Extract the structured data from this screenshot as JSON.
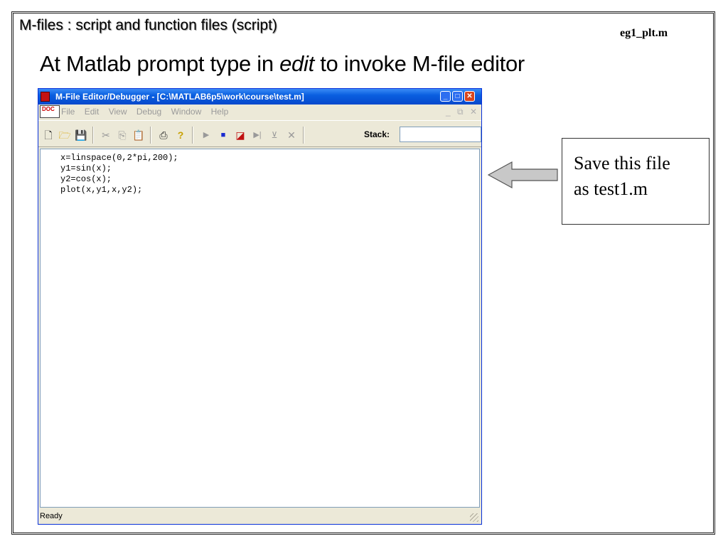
{
  "slide": {
    "title": "M-files : script and function files (script)",
    "file_tag": "eg1_plt.m",
    "subtitle_prefix": "At Matlab prompt type in ",
    "subtitle_emph": "edit",
    "subtitle_suffix": " to invoke M-file editor",
    "callout_line1": "Save this file",
    "callout_line2": "as test1.m"
  },
  "editor_window": {
    "title": "M-File Editor/Debugger - [C:\\MATLAB6p5\\work\\course\\test.m]",
    "doc_icon_text": "DOC",
    "menu": [
      "File",
      "Edit",
      "View",
      "Debug",
      "Window",
      "Help"
    ],
    "stack_label": "Stack:",
    "stack_value": "",
    "code": [
      "x=linspace(0,2*pi,200);",
      "y1=sin(x);",
      "y2=cos(x);",
      "plot(x,y1,x,y2);"
    ],
    "status": "Ready",
    "icons": {
      "minimize": "minimize-icon",
      "maximize": "maximize-icon",
      "close": "close-icon",
      "new": "new-file-icon",
      "open": "open-folder-icon",
      "save": "save-icon",
      "cut": "cut-icon",
      "copy": "copy-icon",
      "paste": "paste-icon",
      "print": "print-icon",
      "help": "help-icon",
      "run": "run-icon",
      "stop": "stop-icon",
      "breakpoint": "breakpoint-icon",
      "step": "step-icon",
      "step_in": "step-in-icon",
      "exit_debug": "exit-debug-icon"
    }
  },
  "colors": {
    "titlebar": "#0a5fe0",
    "window_face": "#ece9d8",
    "close_button": "#d9451e"
  }
}
